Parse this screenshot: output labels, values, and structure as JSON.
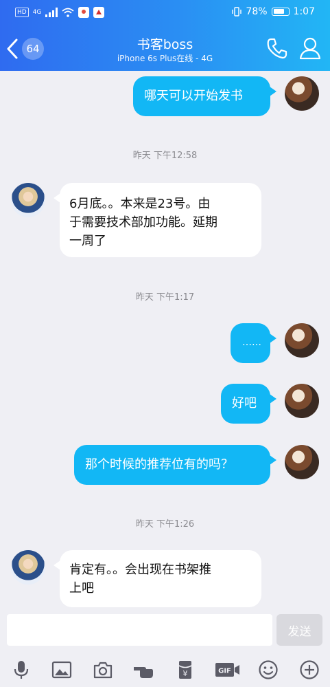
{
  "status_bar": {
    "network_chip": "HD",
    "signal_label": "4G",
    "battery": "78%",
    "battery_level": 0.78,
    "time": "1:07"
  },
  "header": {
    "back_badge": "64",
    "title": "书客boss",
    "subtitle": "iPhone 6s Plus在线 - 4G",
    "icons": [
      "back-chevron-icon",
      "phone-icon",
      "contact-profile-icon"
    ]
  },
  "messages": {
    "m1": {
      "side": "right",
      "text": "哪天可以开始发书"
    },
    "t1": "昨天 下午12:58",
    "m2": {
      "side": "left",
      "line1": "6月底。。本来是23号。由",
      "line2": "于需要技术部加功能。延期",
      "line3": "一周了"
    },
    "t2": "昨天 下午1:17",
    "m3": {
      "side": "right",
      "text": "……"
    },
    "m4": {
      "side": "right",
      "text": "好吧"
    },
    "m5": {
      "side": "right",
      "text": "那个时候的推荐位有的吗？"
    },
    "t3": "昨天 下午1:26",
    "m6": {
      "side": "left",
      "line1": "肯定有。。会出现在书架推",
      "line2": "上吧"
    }
  },
  "input": {
    "value": "",
    "send_label": "发送"
  },
  "toolbar": {
    "icons": [
      "microphone-icon",
      "image-icon",
      "camera-icon",
      "hand-icon",
      "red-packet-icon",
      "gif-icon",
      "emoji-icon",
      "plus-icon"
    ],
    "gif_label": "GIF",
    "red_packet_glyph": "¥"
  },
  "colors": {
    "header_start": "#2f6bf0",
    "header_end": "#22b6f5",
    "bubble_self": "#12b7f5",
    "bubble_other": "#ffffff",
    "background": "#efeff4"
  }
}
